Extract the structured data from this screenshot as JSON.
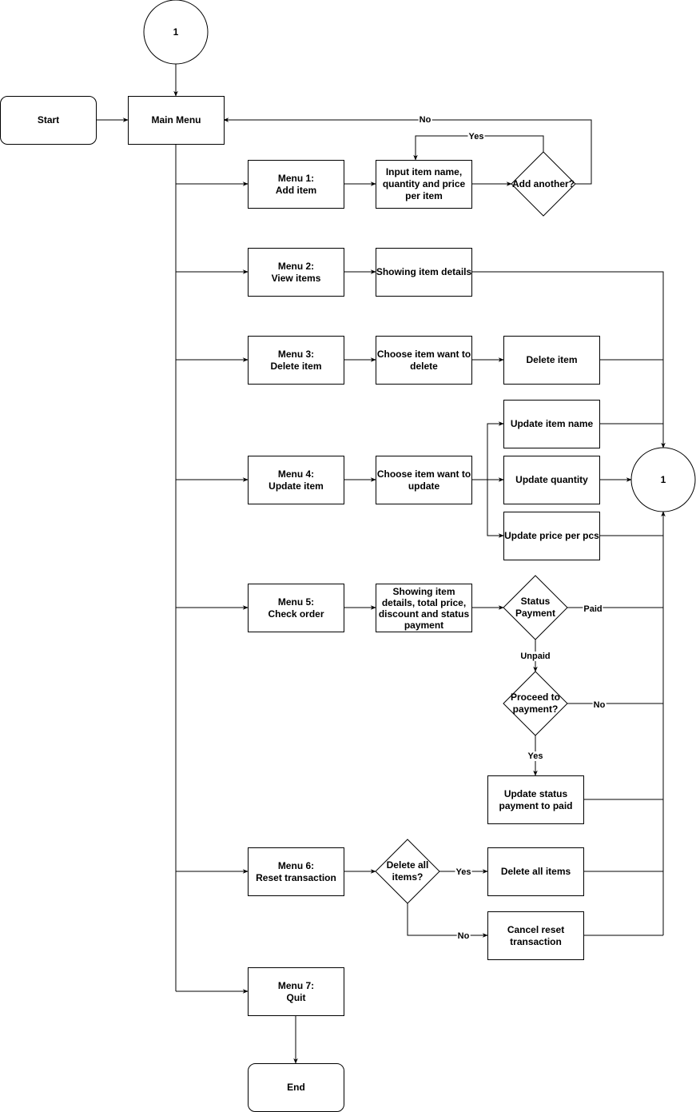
{
  "diagram": {
    "type": "flowchart",
    "nodes": {
      "connector_top": "1",
      "start": "Start",
      "main_menu": "Main Menu",
      "menu1": "Menu 1:\nAdd item",
      "input_item": "Input item name,\nquantity and price\nper item",
      "add_another": "Add another?",
      "menu2": "Menu 2:\nView items",
      "show_details": "Showing item details",
      "menu3": "Menu 3:\nDelete item",
      "choose_delete": "Choose item want to\ndelete",
      "delete_item": "Delete item",
      "update_name": "Update item name",
      "menu4": "Menu 4:\nUpdate item",
      "choose_update": "Choose item want to\nupdate",
      "update_quantity": "Update quantity",
      "connector_right": "1",
      "update_price": "Update price per pcs",
      "menu5": "Menu 5:\nCheck order",
      "show_order": "Showing item\ndetails, total price,\ndiscount and status\npayment",
      "status_payment": "Status\nPayment",
      "proceed_payment": "Proceed to\npayment?",
      "update_status": "Update status\npayment to paid",
      "menu6": "Menu 6:\nReset transaction",
      "delete_all_q": "Delete all\nitems?",
      "delete_all": "Delete all items",
      "cancel_reset": "Cancel reset\ntransaction",
      "menu7": "Menu 7:\nQuit",
      "end": "End"
    },
    "edge_labels": {
      "add_another_no": "No",
      "add_another_yes": "Yes",
      "status_paid": "Paid",
      "status_unpaid": "Unpaid",
      "proceed_no": "No",
      "proceed_yes": "Yes",
      "delete_all_yes": "Yes",
      "delete_all_no": "No"
    },
    "edges": [
      [
        "connector_top",
        "main_menu",
        ""
      ],
      [
        "start",
        "main_menu",
        ""
      ],
      [
        "main_menu",
        "menu1",
        ""
      ],
      [
        "main_menu",
        "menu2",
        ""
      ],
      [
        "main_menu",
        "menu3",
        ""
      ],
      [
        "main_menu",
        "menu4",
        ""
      ],
      [
        "main_menu",
        "menu5",
        ""
      ],
      [
        "main_menu",
        "menu6",
        ""
      ],
      [
        "main_menu",
        "menu7",
        ""
      ],
      [
        "menu1",
        "input_item",
        ""
      ],
      [
        "input_item",
        "add_another",
        ""
      ],
      [
        "add_another",
        "input_item",
        "Yes"
      ],
      [
        "add_another",
        "main_menu",
        "No"
      ],
      [
        "menu2",
        "show_details",
        ""
      ],
      [
        "show_details",
        "connector_right",
        ""
      ],
      [
        "menu3",
        "choose_delete",
        ""
      ],
      [
        "choose_delete",
        "delete_item",
        ""
      ],
      [
        "delete_item",
        "connector_right",
        ""
      ],
      [
        "menu4",
        "choose_update",
        ""
      ],
      [
        "choose_update",
        "update_name",
        ""
      ],
      [
        "choose_update",
        "update_quantity",
        ""
      ],
      [
        "choose_update",
        "update_price",
        ""
      ],
      [
        "update_name",
        "connector_right",
        ""
      ],
      [
        "update_quantity",
        "connector_right",
        ""
      ],
      [
        "update_price",
        "connector_right",
        ""
      ],
      [
        "menu5",
        "show_order",
        ""
      ],
      [
        "show_order",
        "status_payment",
        ""
      ],
      [
        "status_payment",
        "connector_right",
        "Paid"
      ],
      [
        "status_payment",
        "proceed_payment",
        "Unpaid"
      ],
      [
        "proceed_payment",
        "connector_right",
        "No"
      ],
      [
        "proceed_payment",
        "update_status",
        "Yes"
      ],
      [
        "update_status",
        "connector_right",
        ""
      ],
      [
        "menu6",
        "delete_all_q",
        ""
      ],
      [
        "delete_all_q",
        "delete_all",
        "Yes"
      ],
      [
        "delete_all_q",
        "cancel_reset",
        "No"
      ],
      [
        "delete_all",
        "connector_right",
        ""
      ],
      [
        "cancel_reset",
        "connector_right",
        ""
      ],
      [
        "menu7",
        "end",
        ""
      ]
    ]
  }
}
